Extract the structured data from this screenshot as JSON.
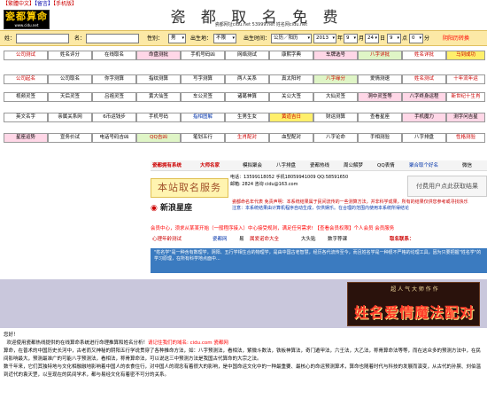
{
  "topbar": {
    "lang_prefix": "【繁體中文】",
    "guestbook": "【留言】",
    "mobile": "【手机版】"
  },
  "logo": {
    "main": "瓷都算命",
    "url": "www.cidu.net"
  },
  "site": {
    "title": "瓷 都 取 名 免 费 算 命",
    "subtitle": "瓷都网址cidu.net 53999.net 姓名网cidu.net"
  },
  "form": {
    "surname_label": "姓：",
    "name_label": "名：",
    "gender_label": "性别：",
    "gender_value": "男",
    "place_label": "出生地：",
    "place_value": "不限",
    "birth_label": "出生时间：",
    "calendar_value": "公历／阳历",
    "year_value": "2013",
    "year_unit": "年",
    "month_value": "9",
    "month_unit": "月",
    "day_value": "24",
    "day_unit": "日",
    "hour_value": "9",
    "hour_unit": "点",
    "minute_value": "0",
    "minute_unit": "分",
    "convert_link": "阴阳历转换"
  },
  "buttons": [
    [
      "公司测试",
      "姓名评分",
      "在线取名",
      "命盘测批",
      "手机号码凶",
      "网络测试",
      "康熙字典",
      "车牌选号",
      "八字详批",
      "姓名详批",
      "马到成功"
    ],
    [
      "公司起名",
      "公司取名",
      "你字测算",
      "指纹测算",
      "写字测算",
      "两人关系",
      "真太阳时",
      "八字缘分",
      "爱情测速",
      "姓名测试",
      "十年流年运"
    ],
    [
      "视频灵签",
      "天后灵签",
      "吕祖灵签",
      "黄大仙签",
      "车公灵签",
      "诸葛神算",
      "关公大签",
      "大仙灵签",
      "洞中灵签等",
      "八字终身运程",
      "新世纪十生肖"
    ],
    [
      "英文名字",
      "亲属关系网",
      "6币运钱步",
      "手机号码",
      "指相图解",
      "生男生女",
      "黄道吉日",
      "财运测算",
      "查看星座",
      "手机魔力",
      "测字问吉星"
    ],
    [
      "星座运势",
      "宣务价试",
      "电话号码吉凶",
      "QQ吉凶",
      "笔划五行",
      "生肖配对",
      "血型配对",
      "八字论命",
      "手相测验",
      "八字排盘",
      "性格测验"
    ]
  ],
  "mid": {
    "tabs": [
      "瓷都拥有系统",
      "大师名家",
      "模拟聚会",
      "八字排盘",
      "瓷都热线",
      "周公解梦",
      "QQ表情",
      "聚合取个好名",
      "微信"
    ],
    "box_left": "本站取名服务",
    "contact_line1": "电话：13599118052  手机18059941009  QQ:58591650",
    "contact_line2": "邮箱: 2824  咨询  cidu@163.com",
    "box_right": "付费用户点此获取结果",
    "sina": "新浪星座",
    "notice1": "瓷都命名年代表  免责声明：本系统结果属于民间流传的一些测算方法，并非科学成果，所有的结果仅供您参考或寻找快乐",
    "notice2": "注意：本系统结果由计算机程序自动生成，仅供娱乐。在合理的范围内使用本系统所得结论"
  },
  "strip": {
    "red_text": "会员中心，须求从某某开始（一般程序接入）中心接受规则，满足任何需求!  【查看会员权限】个人会员  会员服务",
    "nav": [
      "心理年龄测试",
      "瓷都网",
      "易",
      "属爱诺命大全",
      "大头贴",
      "数字荐课",
      "取名联系："
    ],
    "body": "\"姓名学\"是一种含有数理学，阴阳、五行学相生合的物理学，是由中国古老智慧，经历各代流传至今，而且姓名学是一种很不严格的论理工具，因为只要把握\"姓名学\"的学习原理，在所有科学地点面中..."
  },
  "banner": {
    "small": "超 人 气 大 师 作 作",
    "big": "姓名爱情魔法配对"
  },
  "article": {
    "greeting": "您好！",
    "line1_a": "欢迎使用瓷都热线提供的在线算命系统进行命理推算和姓名分析！",
    "line1_b": "请记住我们的域名: cidu.com 瓷都网",
    "line2": "算命，在普术的中国历史长河中，古老而又神秘的阴阳五行学说贯穿了各种推命方法，如：八字预测法，看相法，紫微斗数法，铁板神算法，奇门遁甲法，六壬法，大乙法，称骨算命法等等，而在这众多的预测方法中，在民间影响最大，预测最准广的可能八字预测法，看相法，称骨算命法，可以说这三中预测方法是我国古代算命的大宗之法。",
    "line3": "数千年来，它们其独特地与文化相融融地影响着中国人的衣食住行，对中国人的观念有着很大的影响，是中国命运文化中的一种最重要、最核心的命运预测算术，算命也随着时代与科技的发展而演变，从古代的孙膑、刘伯温到近代的袁天罡，以至现在的民间学术，都与易经文化有着密不可分的关系。"
  }
}
